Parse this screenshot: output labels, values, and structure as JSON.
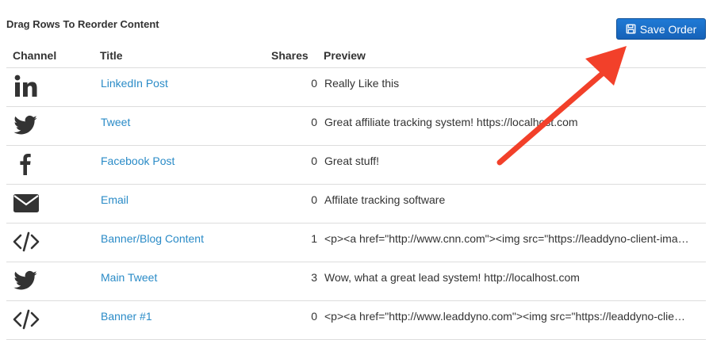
{
  "heading": "Drag Rows To Reorder Content",
  "save_button": {
    "label": "Save Order",
    "icon": "save-icon",
    "color": "#1a6fc9"
  },
  "columns": {
    "channel": "Channel",
    "title": "Title",
    "shares": "Shares",
    "preview": "Preview"
  },
  "rows": [
    {
      "channel_icon": "linkedin-icon",
      "title": "LinkedIn Post",
      "shares": "0",
      "preview": "Really Like this"
    },
    {
      "channel_icon": "twitter-icon",
      "title": "Tweet",
      "shares": "0",
      "preview": "Great affiliate tracking system! https://localhost.com"
    },
    {
      "channel_icon": "facebook-icon",
      "title": "Facebook Post",
      "shares": "0",
      "preview": "Great stuff!"
    },
    {
      "channel_icon": "envelope-icon",
      "title": "Email",
      "shares": "0",
      "preview": "Affilate tracking software"
    },
    {
      "channel_icon": "code-icon",
      "title": "Banner/Blog Content",
      "shares": "1",
      "preview": "<p><a href=\"http://www.cnn.com\"><img src=\"https://leaddyno-client-ima…"
    },
    {
      "channel_icon": "twitter-icon",
      "title": "Main Tweet",
      "shares": "3",
      "preview": "Wow, what a great lead system! http://localhost.com"
    },
    {
      "channel_icon": "code-icon",
      "title": "Banner #1",
      "shares": "0",
      "preview": "<p><a href=\"http://www.leaddyno.com\"><img src=\"https://leaddyno-clie…"
    }
  ],
  "colors": {
    "link": "#2a8bc7",
    "arrow": "#f2402a"
  }
}
